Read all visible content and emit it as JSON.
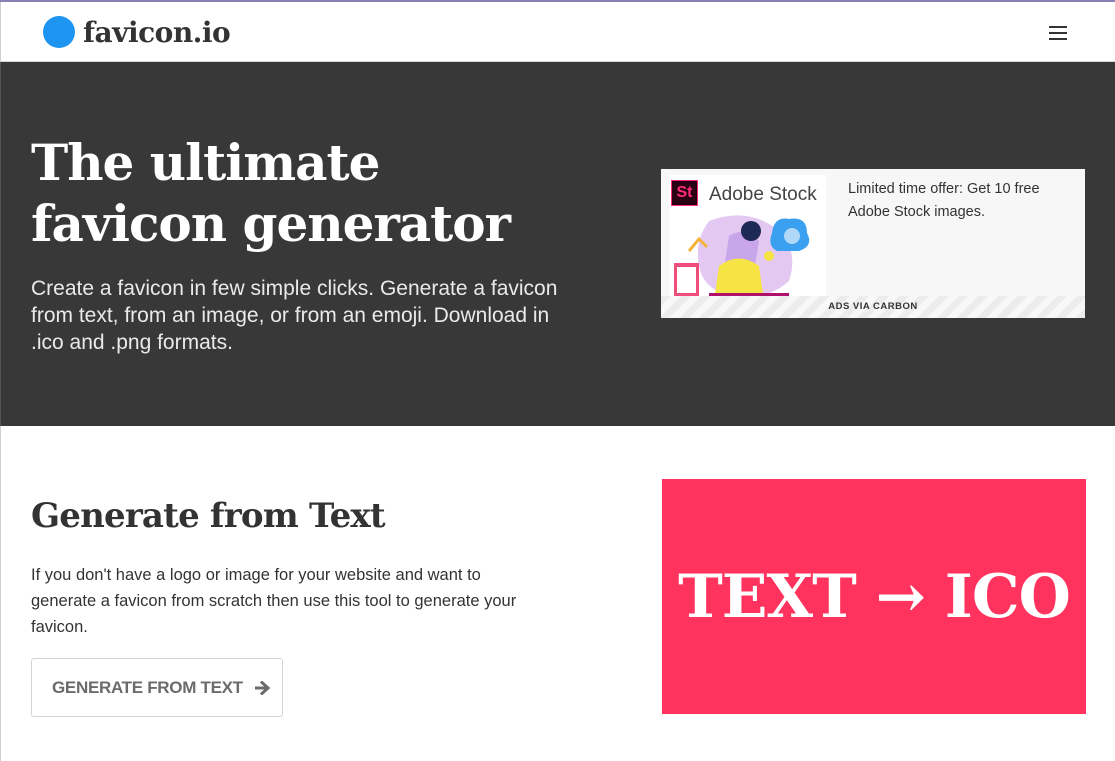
{
  "navbar": {
    "brand_text": "favicon.io",
    "menu_icon": "hamburger-menu-icon"
  },
  "hero": {
    "title_line1": "The ultimate",
    "title_line2": "favicon generator",
    "subtitle": "Create a favicon in few simple clicks. Generate a favicon from text, from an image, or from an emoji. Download in .ico and .png formats."
  },
  "ad": {
    "logo_mark": "St",
    "brand": "Adobe Stock",
    "copy": "Limited time offer: Get 10 free Adobe Stock images.",
    "via": "ADS VIA CARBON"
  },
  "text_section": {
    "title": "Generate from Text",
    "description": "If you don't have a logo or image for your website and want to generate a favicon from scratch then use this tool to generate your favicon.",
    "button_label": "GENERATE FROM TEXT",
    "button_icon": "arrow-right-icon",
    "banner_text": "TEXT → ICO"
  },
  "colors": {
    "brand_dot": "#1e95f0",
    "hero_bg": "#383838",
    "banner_bg": "#ff335d"
  }
}
